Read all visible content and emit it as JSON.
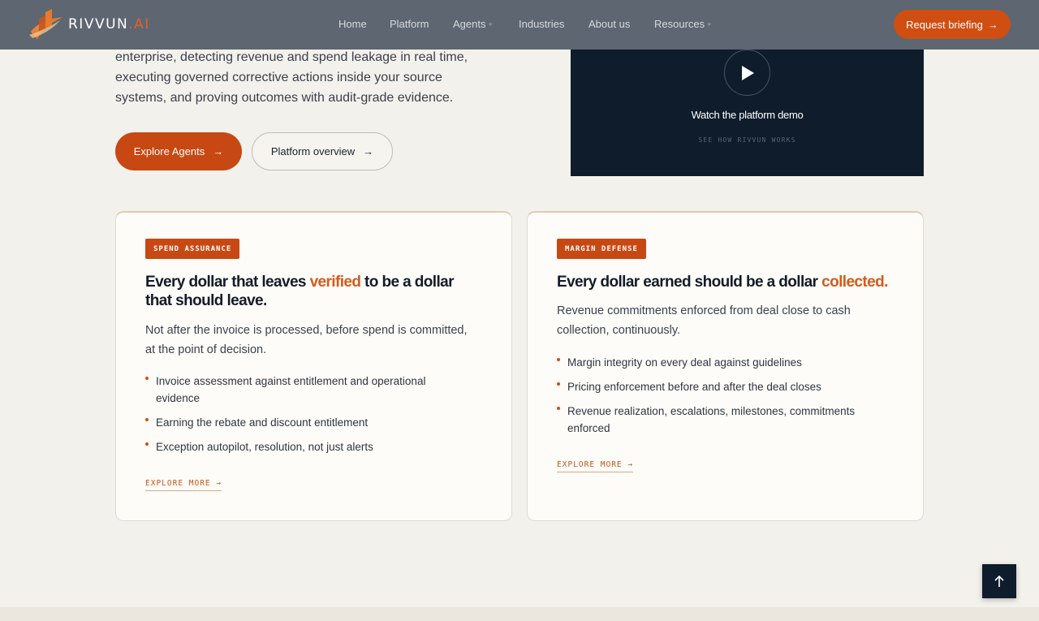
{
  "brand": {
    "name_main": "RIVVUN",
    "name_dot": ".",
    "name_ai": "AI",
    "accent": "#d04e12"
  },
  "nav": {
    "links": [
      {
        "label": "Home",
        "has_caret": false
      },
      {
        "label": "Platform",
        "has_caret": false
      },
      {
        "label": "Agents",
        "has_caret": true
      },
      {
        "label": "Industries",
        "has_caret": false
      },
      {
        "label": "About us",
        "has_caret": false
      },
      {
        "label": "Resources",
        "has_caret": true
      }
    ],
    "caret": "+",
    "cta_label": "Request briefing",
    "cta_arrow": "→"
  },
  "hero": {
    "description": "enterprise, detecting revenue and spend leakage in real time, executing governed corrective actions inside your source systems, and proving outcomes with audit-grade evidence.",
    "primary_label": "Explore Agents",
    "secondary_label": "Platform overview",
    "arrow": "→"
  },
  "video": {
    "title": "Watch the platform demo",
    "subtitle": "SEE HOW RIVVUN WORKS",
    "play_icon": "play-icon"
  },
  "cards": {
    "spend": {
      "badge": "SPEND ASSURANCE",
      "title_pre": "Every dollar that leaves ",
      "title_hl": "verified",
      "title_post": " to be a dollar that should leave.",
      "description": "Not after the invoice is processed, before spend is committed, at the point of decision.",
      "items": [
        "Invoice assessment against entitlement and operational evidence",
        "Earning the rebate and discount entitlement",
        "Exception autopilot, resolution, not just alerts"
      ],
      "link": "EXPLORE MORE →"
    },
    "margin": {
      "badge": "MARGIN DEFENSE",
      "title_pre": "Every dollar earned should be a dollar ",
      "title_hl": "collected.",
      "title_post": "",
      "description": "Revenue commitments enforced from deal close to cash collection, continuously.",
      "items": [
        "Margin integrity on every deal against guidelines",
        "Pricing enforcement before and after the deal closes",
        "Revenue realization, escalations, milestones, commitments enforced"
      ],
      "link": "EXPLORE MORE →"
    }
  },
  "scroll_top": {
    "icon": "arrow-up-icon"
  }
}
